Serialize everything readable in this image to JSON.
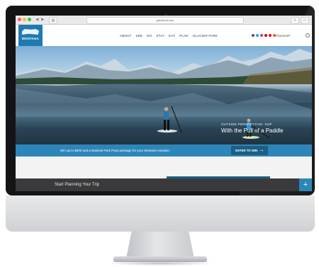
{
  "browser": {
    "url": "glaciermt.com",
    "back_icon": "chevron-left-icon",
    "forward_icon": "chevron-right-icon",
    "window_controls": {
      "close": "#ff5f57",
      "minimize": "#febc2e",
      "zoom": "#28c840"
    }
  },
  "header": {
    "logo_text": "MONTANA",
    "nav_items": [
      "ABOUT",
      "SEE",
      "DO",
      "STAY",
      "EAT",
      "PLAN",
      "GLACIER PARK"
    ],
    "hashtag": "#GlacierMT",
    "social_colors": [
      "#3b5998",
      "#1da1f2",
      "#e1306c",
      "#bd081c",
      "#ff0000",
      "#f26522"
    ]
  },
  "hero": {
    "subtitle": "OUTSIDE PERSPECTIVE: SUP",
    "title": "With the Pull of a Paddle"
  },
  "promo": {
    "text": "Win up to $500 and a National Park Pass package for your Montana vacation.",
    "button_label": "ENTER TO WIN",
    "arrow": "→"
  },
  "footer": {
    "label": "Start Planning Your Trip",
    "plus": "+"
  },
  "colors": {
    "brand_blue": "#2d86ba",
    "dark_blue": "#1c5e86",
    "footer_gray": "#3a3a3c"
  }
}
